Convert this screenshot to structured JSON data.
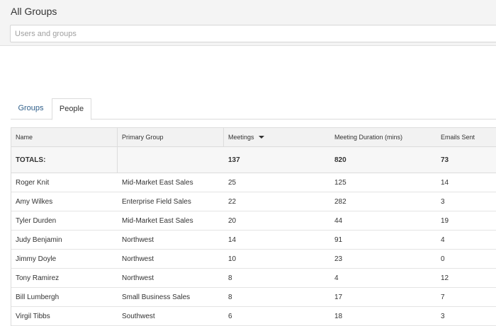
{
  "header": {
    "title": "All Groups",
    "search_placeholder": "Users and groups"
  },
  "tabs": [
    {
      "label": "Groups",
      "active": false
    },
    {
      "label": "People",
      "active": true
    }
  ],
  "table": {
    "columns": [
      "Name",
      "Primary Group",
      "Meetings",
      "Meeting Duration (mins)",
      "Emails Sent"
    ],
    "sorted_column": "Meetings",
    "sort_direction": "desc",
    "totals": {
      "label": "TOTALS:",
      "meetings": "137",
      "duration": "820",
      "emails": "73"
    },
    "rows": [
      {
        "name": "Roger Knit",
        "group": "Mid-Market East Sales",
        "meetings": "25",
        "duration": "125",
        "emails": "14"
      },
      {
        "name": "Amy Wilkes",
        "group": "Enterprise Field Sales",
        "meetings": "22",
        "duration": "282",
        "emails": "3"
      },
      {
        "name": "Tyler Durden",
        "group": "Mid-Market East Sales",
        "meetings": "20",
        "duration": "44",
        "emails": "19"
      },
      {
        "name": "Judy Benjamin",
        "group": "Northwest",
        "meetings": "14",
        "duration": "91",
        "emails": "4"
      },
      {
        "name": "Jimmy Doyle",
        "group": "Northwest",
        "meetings": "10",
        "duration": "23",
        "emails": "0"
      },
      {
        "name": "Tony Ramirez",
        "group": "Northwest",
        "meetings": "8",
        "duration": "4",
        "emails": "12"
      },
      {
        "name": "Bill Lumbergh",
        "group": "Small Business Sales",
        "meetings": "8",
        "duration": "17",
        "emails": "7"
      },
      {
        "name": "Virgil Tibbs",
        "group": "Southwest",
        "meetings": "6",
        "duration": "18",
        "emails": "3"
      }
    ]
  },
  "colors": {
    "header_bg": "#f4f4f4",
    "link_blue": "#2f5f8a",
    "border": "#dcdcdc"
  }
}
